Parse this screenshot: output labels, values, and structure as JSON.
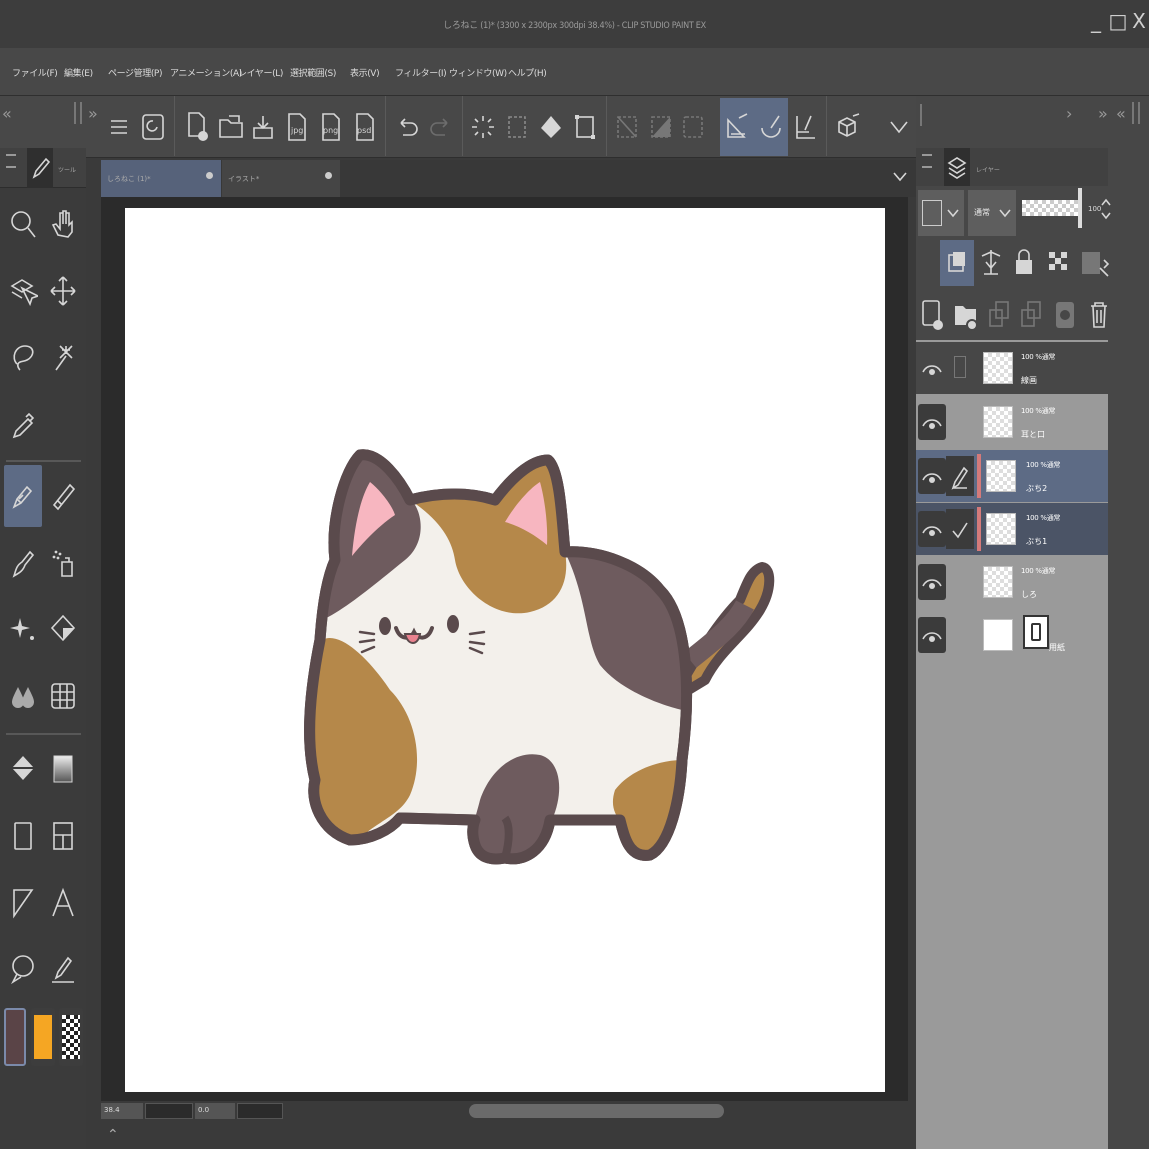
{
  "window": {
    "title": "しろねこ (1)* (3300 x 2300px 300dpi 38.4%)  - CLIP STUDIO PAINT EX",
    "minimize": "_",
    "maximize": "□",
    "close": "X"
  },
  "menu": [
    "ファイル(F)",
    "編集(E)",
    "ページ管理(P)",
    "アニメーション(A)",
    "レイヤー(L)",
    "選択範囲(S)",
    "表示(V)",
    "フィルター(I)",
    "ウィンドウ(W)",
    "ヘルプ(H)"
  ],
  "toolbar": {
    "export_labels": [
      "jpg",
      "png",
      "psd"
    ]
  },
  "tool_panel": {
    "label": "ツール"
  },
  "tabs": [
    {
      "label": "しろねこ (1)*",
      "active": true
    },
    {
      "label": "イラスト*",
      "active": false
    }
  ],
  "layer_panel": {
    "label": "レイヤー",
    "blend_mode": "通常",
    "opacity": "100",
    "layers": [
      {
        "mode": "100 %通常",
        "name": "線画",
        "selected": false
      },
      {
        "mode": "100 %通常",
        "name": "耳と口",
        "selected": false
      },
      {
        "mode": "100 %通常",
        "name": "ぶち2",
        "selected": true
      },
      {
        "mode": "100 %通常",
        "name": "ぶち1",
        "selected": true
      },
      {
        "mode": "100 %通常",
        "name": "しろ",
        "selected": false
      },
      {
        "mode": "",
        "name": "用紙",
        "selected": false
      }
    ]
  },
  "status": {
    "zoom": "38.4",
    "rotation": "0.0"
  },
  "colors": {
    "main_color": "#5a4447",
    "sub_color": "#f5a623",
    "accent": "#5d6b85",
    "cat_outline": "#5a4a4c",
    "cat_white": "#f3f0eb",
    "cat_brown": "#b5884a",
    "cat_dark": "#6e5b5e",
    "cat_ear_pink": "#f7b6c0"
  }
}
